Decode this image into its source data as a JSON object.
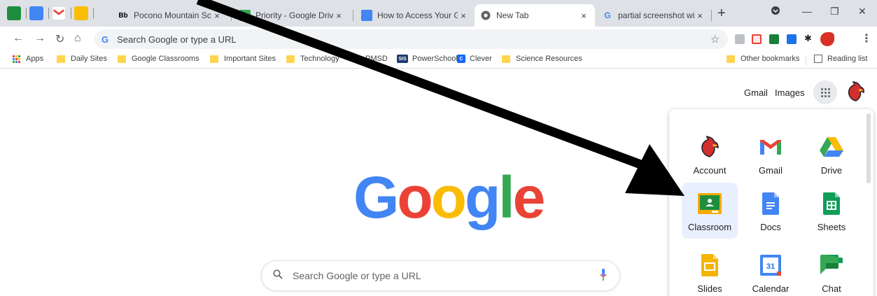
{
  "tabs": [
    {
      "favicon": "Bb",
      "title": "Pocono Mountain Scho",
      "active": false
    },
    {
      "favicon": "drive",
      "title": "Priority - Google Drive",
      "active": false
    },
    {
      "favicon": "docs",
      "title": "How to Access Your Go",
      "active": false
    },
    {
      "favicon": "chrome",
      "title": "New Tab",
      "active": true
    },
    {
      "favicon": "G",
      "title": "partial screenshot wind",
      "active": false
    }
  ],
  "tab_close": "×",
  "new_tab": "+",
  "window_controls": {
    "minimize": "—",
    "restore": "❐",
    "close": "✕"
  },
  "omnibox": {
    "google_letter": "G",
    "placeholder": "Search Google or type a URL"
  },
  "bookmarks": [
    {
      "label": "Apps",
      "icon": "apps-grid-icon"
    },
    {
      "label": "Daily Sites",
      "icon": "folder-icon"
    },
    {
      "label": "Google Classrooms",
      "icon": "folder-icon"
    },
    {
      "label": "Important Sites",
      "icon": "folder-icon"
    },
    {
      "label": "Technology",
      "icon": "folder-icon"
    },
    {
      "label": "PMSD",
      "icon": "bb-icon",
      "icon_text": "Bb"
    },
    {
      "label": "PowerSchool",
      "icon": "sis-icon",
      "icon_text": "SIS"
    },
    {
      "label": "Clever",
      "icon": "clever-icon",
      "icon_text": "C"
    },
    {
      "label": "Science Resources",
      "icon": "folder-icon"
    }
  ],
  "bookmarks_right": [
    {
      "label": "Other bookmarks",
      "icon": "folder-icon"
    },
    {
      "label": "Reading list",
      "icon": "reading-list-icon"
    }
  ],
  "header_links": {
    "gmail": "Gmail",
    "images": "Images"
  },
  "logo": [
    "G",
    "o",
    "o",
    "g",
    "l",
    "e"
  ],
  "logo_colors": [
    "#4285f4",
    "#ea4335",
    "#fbbc05",
    "#4285f4",
    "#34a853",
    "#ea4335"
  ],
  "search": {
    "placeholder": "Search Google or type a URL"
  },
  "apps_panel": [
    {
      "label": "Account",
      "icon": "account-icon"
    },
    {
      "label": "Gmail",
      "icon": "gmail-icon"
    },
    {
      "label": "Drive",
      "icon": "drive-icon"
    },
    {
      "label": "Classroom",
      "icon": "classroom-icon",
      "highlighted": true
    },
    {
      "label": "Docs",
      "icon": "docs-icon"
    },
    {
      "label": "Sheets",
      "icon": "sheets-icon"
    },
    {
      "label": "Slides",
      "icon": "slides-icon"
    },
    {
      "label": "Calendar",
      "icon": "calendar-icon",
      "icon_text": "31"
    },
    {
      "label": "Chat",
      "icon": "chat-icon"
    }
  ],
  "colors": {
    "tabstrip": "#dee1e6",
    "omnibox": "#f1f3f4",
    "highlight": "#e8f0fe",
    "folder": "#ffd54f",
    "arrow": "#000000"
  }
}
